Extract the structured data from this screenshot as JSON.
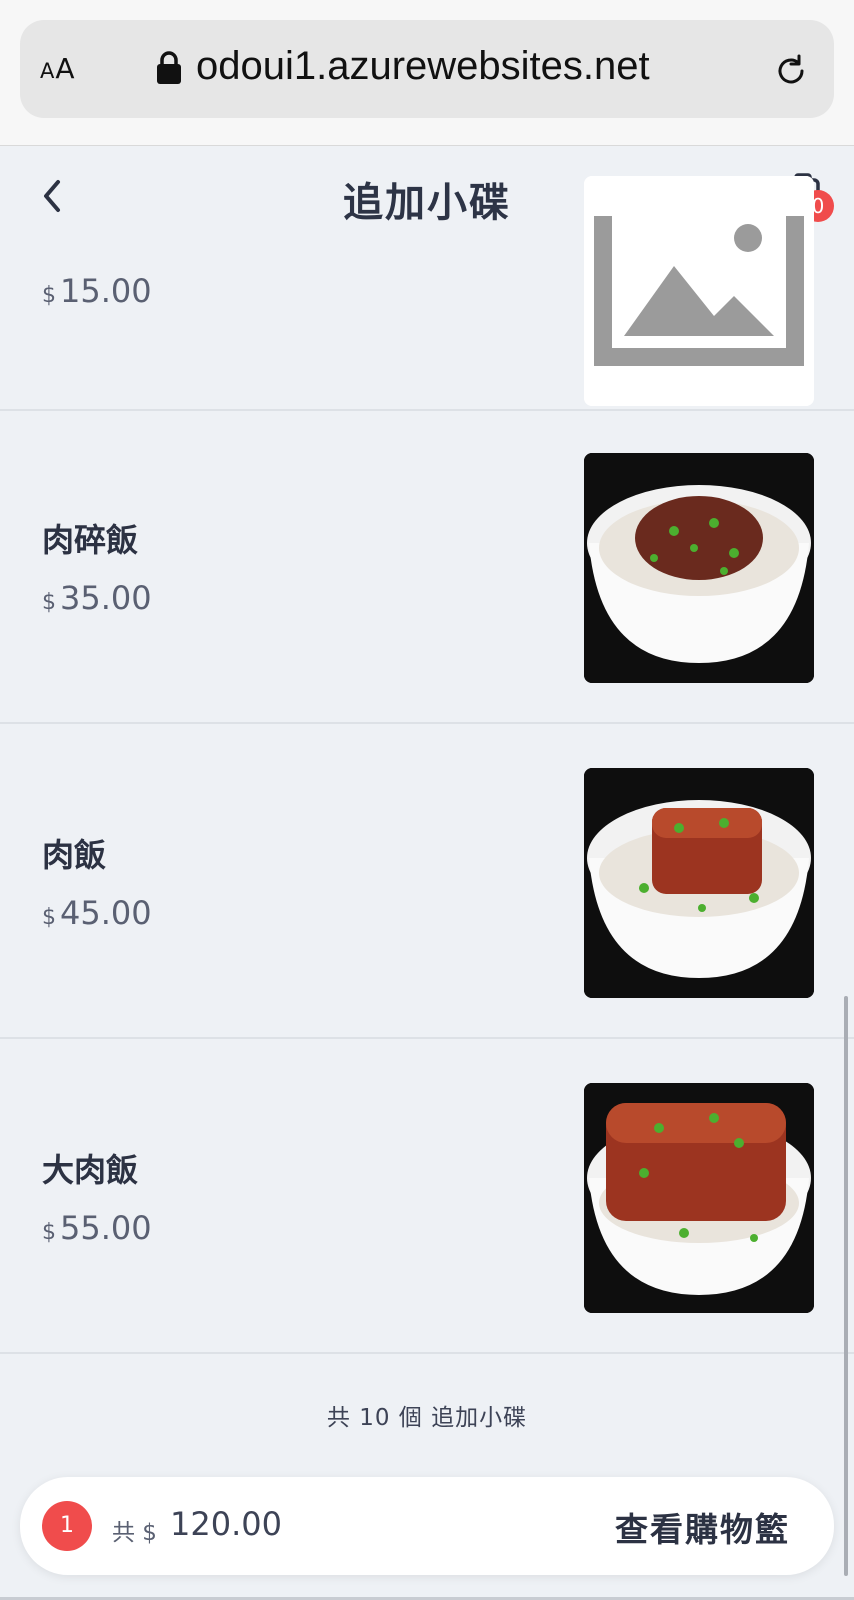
{
  "browser": {
    "text_size_label_small": "A",
    "text_size_label_large": "A",
    "url": "odoui1.azurewebsites.net"
  },
  "header": {
    "title": "追加小碟",
    "cart_badge_count": "0"
  },
  "items": [
    {
      "name": "",
      "currency": "$",
      "price": "15.00",
      "image": "placeholder-image-icon"
    },
    {
      "name": "肉碎飯",
      "currency": "$",
      "price": "35.00",
      "image": "minced-pork-rice-bowl"
    },
    {
      "name": "肉飯",
      "currency": "$",
      "price": "45.00",
      "image": "braised-pork-rice-bowl"
    },
    {
      "name": "大肉飯",
      "currency": "$",
      "price": "55.00",
      "image": "large-braised-pork-rice-bowl"
    }
  ],
  "summary": {
    "text": "共 10 個 追加小碟"
  },
  "cart_bar": {
    "count": "1",
    "total_prefix": "共 $",
    "total_value": "120.00",
    "view_cart_label": "查看購物籃"
  },
  "colors": {
    "background": "#eef1f5",
    "accent_red": "#f04c4c",
    "text_dark": "#2c3243"
  }
}
